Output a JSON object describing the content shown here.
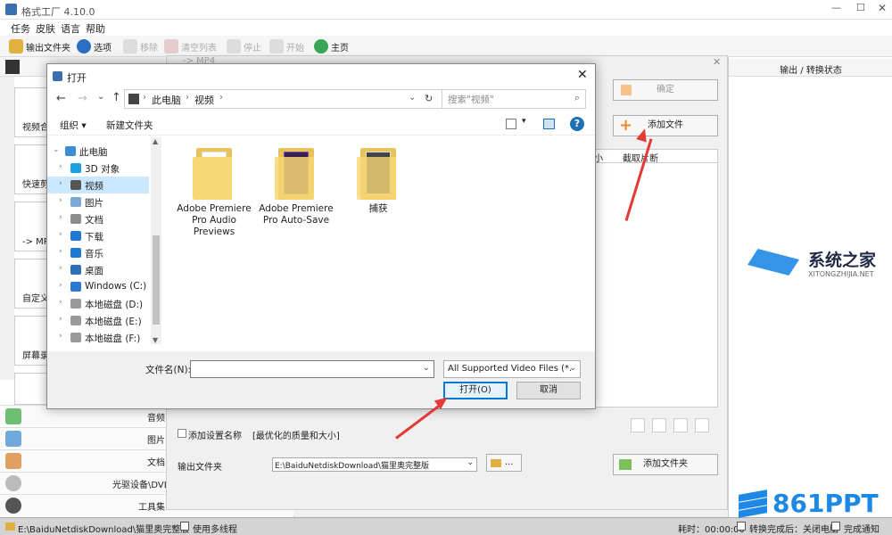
{
  "app": {
    "title": "格式工厂 4.10.0",
    "menu": [
      "任务",
      "皮肤",
      "语言",
      "帮助"
    ],
    "toolbar": {
      "output_folder": "输出文件夹",
      "options": "选项",
      "remove": "移除",
      "clear_list": "清空列表",
      "stop": "停止",
      "start": "开始",
      "home": "主页"
    },
    "left_categories": {
      "video_merge": "视频合",
      "quick_clip": "快速剪",
      "to_mp4": "-> MP",
      "custom": "自定义",
      "screen_record": "屏幕录",
      "audio": "音频",
      "picture": "图片",
      "document": "文档",
      "optical": "光驱设备\\DVD\\CD\\ISO",
      "toolset": "工具集"
    }
  },
  "convert_panel": {
    "title": "-> MP4",
    "ok_button": "确定",
    "add_file_button": "添加文件",
    "col_size": "小",
    "col_clip": "截取片断",
    "add_setting_name": "添加设置名称",
    "quality_hint": "[最优化的质量和大小]",
    "output_folder_label": "输出文件夹",
    "output_path": "E:\\BaiduNetdiskDownload\\猫里奥完整版",
    "more_button": "...",
    "add_folder_button": "添加文件夹"
  },
  "right_pane": {
    "header": "输出 / 转换状态"
  },
  "status_bar": {
    "path": "E:\\BaiduNetdiskDownload\\猫里奥完整版",
    "multithread": "使用多线程",
    "elapsed": "耗时：00:00:00",
    "shutdown_after": "转换完成后：关闭电脑",
    "notify": "完成通知"
  },
  "dialog": {
    "title": "打开",
    "address": [
      "此电脑",
      "视频"
    ],
    "search_placeholder": "搜索\"视频\"",
    "organize": "组织 ▾",
    "new_folder": "新建文件夹",
    "nav_items": [
      {
        "label": "此电脑",
        "color": "#3b8fd6"
      },
      {
        "label": "3D 对象",
        "color": "#1ba1e2"
      },
      {
        "label": "视频",
        "color": "#555555"
      },
      {
        "label": "图片",
        "color": "#7aa7d6"
      },
      {
        "label": "文档",
        "color": "#8c8c8c"
      },
      {
        "label": "下载",
        "color": "#1f78d1"
      },
      {
        "label": "音乐",
        "color": "#1f78d1"
      },
      {
        "label": "桌面",
        "color": "#2f6fb7"
      },
      {
        "label": "Windows (C:)",
        "color": "#2b79d0"
      },
      {
        "label": "本地磁盘 (D:)",
        "color": "#9a9a9a"
      },
      {
        "label": "本地磁盘 (E:)",
        "color": "#9a9a9a"
      },
      {
        "label": "本地磁盘 (F:)",
        "color": "#9a9a9a"
      }
    ],
    "files": [
      {
        "name": "Adobe Premiere Pro Audio Previews"
      },
      {
        "name": "Adobe Premiere Pro Auto-Save"
      },
      {
        "name": "捕获"
      }
    ],
    "filename_label": "文件名(N):",
    "filename_value": "",
    "filter": "All Supported Video Files (*.",
    "open_button": "打开(O)",
    "cancel_button": "取消"
  },
  "watermarks": {
    "site_name": "系统之家",
    "site_url": "XITONGZHIJIA.NET",
    "brand": "861PPT"
  },
  "colors": {
    "accent": "#0078d7",
    "annotation_arrow": "#e53935",
    "folder_yellow": "#f7d774",
    "watermark_blue": "#1e88e5"
  }
}
